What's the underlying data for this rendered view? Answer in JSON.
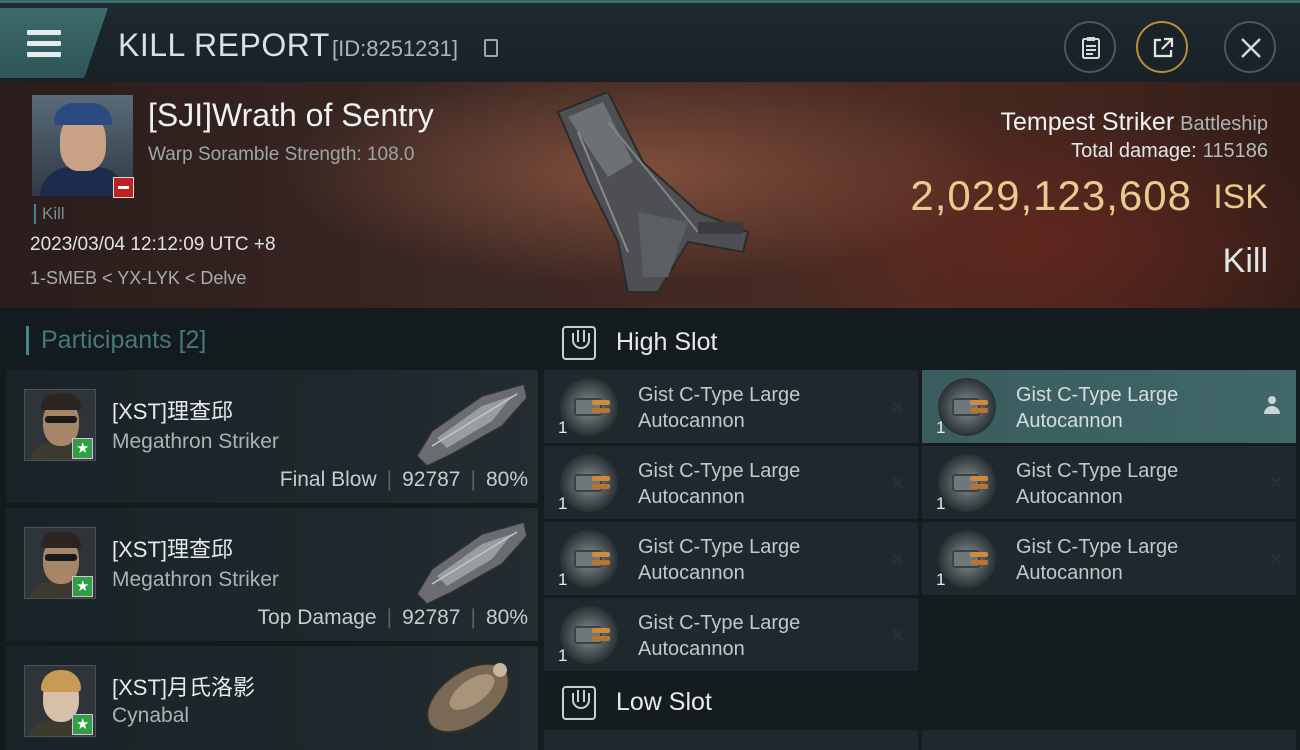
{
  "header": {
    "title": "KILL REPORT",
    "report_id": "[ID:8251231]"
  },
  "victim": {
    "name": "[SJI]Wrath of Sentry",
    "warp_scramble": "Warp Soramble Strength: 108.0",
    "kill_tag": "Kill",
    "datetime": "2023/03/04 12:12:09 UTC +8",
    "location": "1-SMEB < YX-LYK < Delve"
  },
  "ship": {
    "name": "Tempest Striker",
    "class": "Battleship",
    "total_damage_label": "Total damage:",
    "total_damage": "115186",
    "isk_value": "2,029,123,608",
    "isk_unit": "ISK",
    "result": "Kill"
  },
  "participants": {
    "title": "Participants",
    "count": "[2]",
    "items": [
      {
        "name": "[XST]理查邱",
        "ship": "Megathron Striker",
        "tag": "Final Blow",
        "damage": "92787",
        "percent": "80%"
      },
      {
        "name": "[XST]理查邱",
        "ship": "Megathron Striker",
        "tag": "Top Damage",
        "damage": "92787",
        "percent": "80%"
      },
      {
        "name": "[XST]月氏洛影",
        "ship": "Cynabal"
      }
    ]
  },
  "fitting": {
    "high_slot_label": "High Slot",
    "low_slot_label": "Low Slot",
    "high_slot": [
      {
        "qty": "1",
        "name_line1": "Gist C-Type Large",
        "name_line2": "Autocannon",
        "marker": "×"
      },
      {
        "qty": "1",
        "name_line1": "Gist C-Type Large",
        "name_line2": "Autocannon",
        "marker": "person"
      },
      {
        "qty": "1",
        "name_line1": "Gist C-Type Large",
        "name_line2": "Autocannon",
        "marker": "×"
      },
      {
        "qty": "1",
        "name_line1": "Gist C-Type Large",
        "name_line2": "Autocannon",
        "marker": "×"
      },
      {
        "qty": "1",
        "name_line1": "Gist C-Type Large",
        "name_line2": "Autocannon",
        "marker": "×"
      },
      {
        "qty": "1",
        "name_line1": "Gist C-Type Large",
        "name_line2": "Autocannon",
        "marker": "×"
      },
      {
        "qty": "1",
        "name_line1": "Gist C-Type Large",
        "name_line2": "Autocannon",
        "marker": "×"
      }
    ]
  }
}
